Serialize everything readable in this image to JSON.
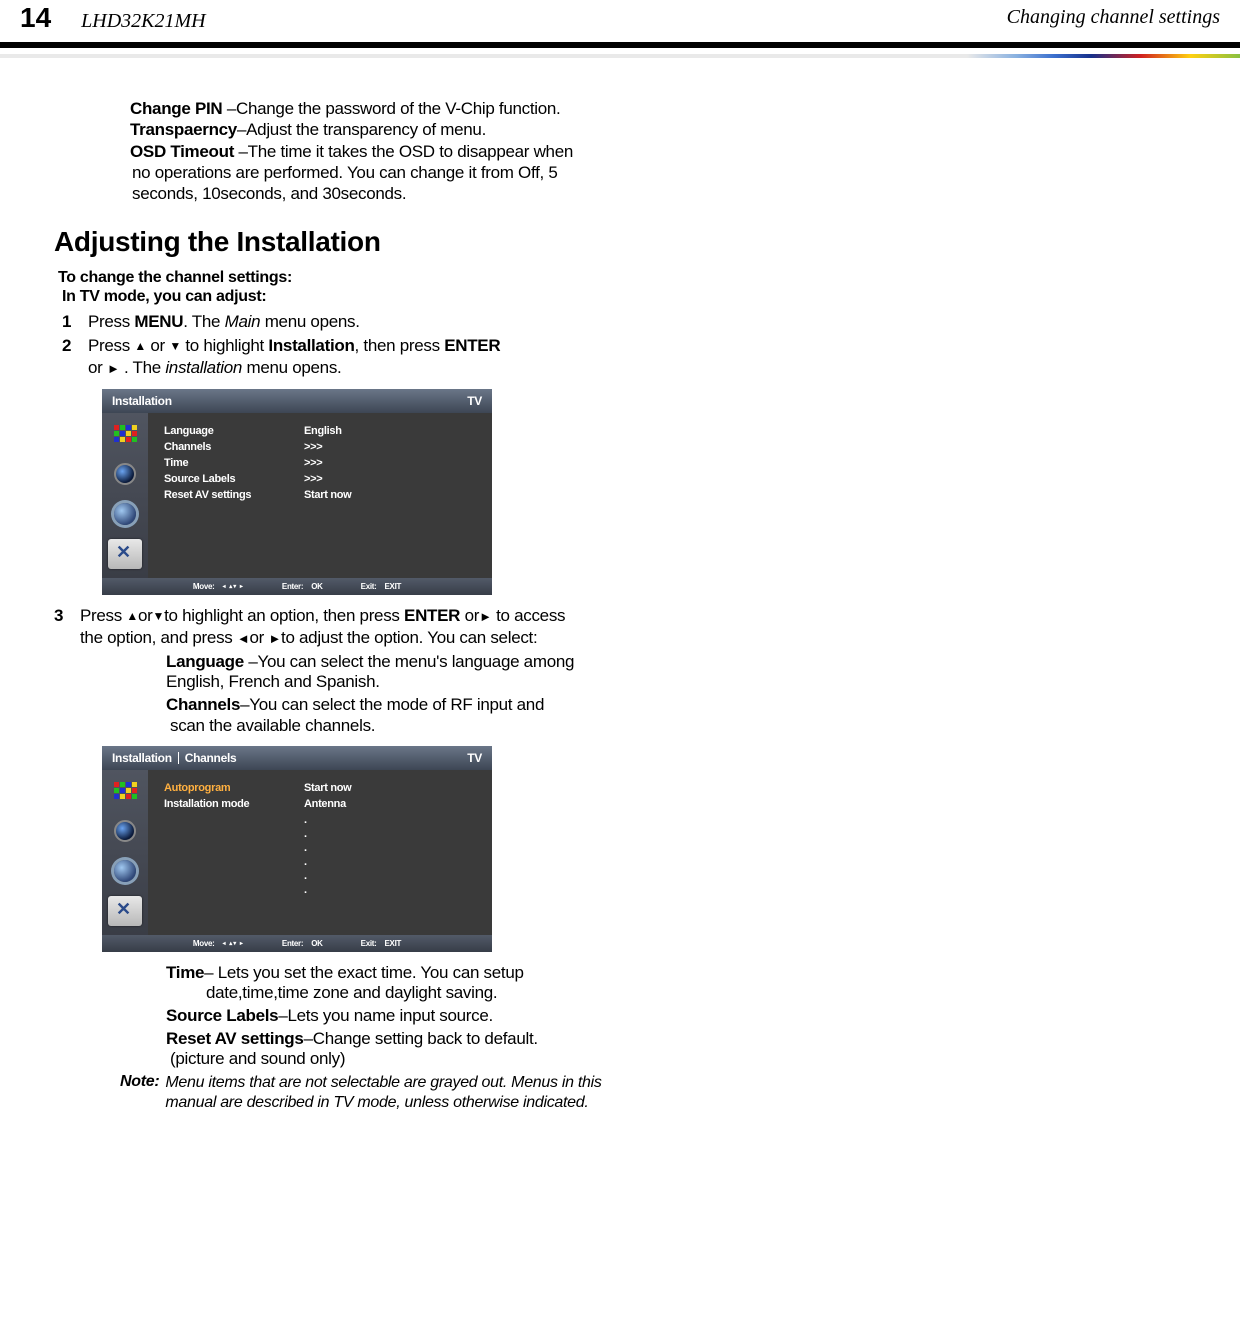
{
  "header": {
    "page_number": "14",
    "model": "LHD32K21MH",
    "section": "Changing channel settings"
  },
  "intro": {
    "change_pin_label": "Change PIN",
    "change_pin_text": " –Change the password of the V-Chip function.",
    "transparency_label": "Transpaerncy",
    "transparency_text": "–Adjust the transparency of menu.",
    "osd_timeout_label": "OSD Timeout",
    "osd_timeout_text_1": " –The time it takes the OSD to disappear when",
    "osd_timeout_text_2": "no operations are performed. You can change it from Off, 5",
    "osd_timeout_text_3": "seconds, 10seconds, and 30seconds."
  },
  "heading": "Adjusting the Installation",
  "subhead_1": "To change the channel settings:",
  "subhead_2": "In TV mode, you can adjust:",
  "steps": {
    "s1_a": "Press ",
    "s1_menu": "MENU",
    "s1_b": ". The ",
    "s1_main": "Main",
    "s1_c": " menu opens.",
    "s2_a": "Press ",
    "s2_b": " or ",
    "s2_c": " to highlight ",
    "s2_install": "Installation",
    "s2_d": ", then press ",
    "s2_enter": "ENTER",
    "s2_e": "or ",
    "s2_f": " . The ",
    "s2_inst2": "installation",
    "s2_g": " menu opens.",
    "s3_a": "Press ",
    "s3_b": "or",
    "s3_c": "to highlight an option, then press ",
    "s3_enter": "ENTER",
    "s3_d": " or",
    "s3_e": " to access",
    "s3_f": "the option, and press ",
    "s3_g": "or ",
    "s3_h": "to adjust  the option. You can select:"
  },
  "osd1": {
    "title": "Installation",
    "mode": "TV",
    "rows": [
      {
        "label": "Language",
        "value": "English"
      },
      {
        "label": "Channels",
        "value": ">>>"
      },
      {
        "label": "Time",
        "value": ">>>"
      },
      {
        "label": "Source Labels",
        "value": ">>>"
      },
      {
        "label": "Reset AV settings",
        "value": "Start now"
      }
    ],
    "footer": {
      "move": "Move:",
      "arrows": "◂ ▴▾ ▸",
      "enter": "Enter:",
      "ok": "OK",
      "exit": "Exit:",
      "exit_val": "EXIT"
    }
  },
  "desc": {
    "lang_label": "Language",
    "lang_text": " –You can select the menu's language among",
    "lang_text2": "English, French and Spanish.",
    "ch_label": "Channels",
    "ch_text": "–You can select the mode of RF input and",
    "ch_text2": "scan the available channels."
  },
  "osd2": {
    "title_a": "Installation",
    "title_b": "Channels",
    "mode": "TV",
    "rows": [
      {
        "label": "Autoprogram",
        "value": "Start now",
        "hl": true
      },
      {
        "label": "Installation mode",
        "value": "Antenna"
      }
    ],
    "dots": [
      ".",
      ".",
      ".",
      ".",
      ".",
      "."
    ],
    "footer": {
      "move": "Move:",
      "arrows": "◂ ▴▾ ▸",
      "enter": "Enter:",
      "ok": "OK",
      "exit": "Exit:",
      "exit_val": "EXIT"
    }
  },
  "desc2": {
    "time_label": "Time",
    "time_text": "– Lets you set the exact time. You can setup",
    "time_text2": "date,time,time zone and daylight saving.",
    "src_label": "Source Labels",
    "src_text": "–Lets you name input source.",
    "reset_label": "Reset AV settings",
    "reset_text": "–Change setting back to default.",
    "reset_text2": "(picture and sound only)"
  },
  "note": {
    "label": "Note:",
    "text1": "Menu items that are not selectable are grayed out. Menus in this",
    "text2": "manual are described in TV mode, unless otherwise indicated."
  }
}
